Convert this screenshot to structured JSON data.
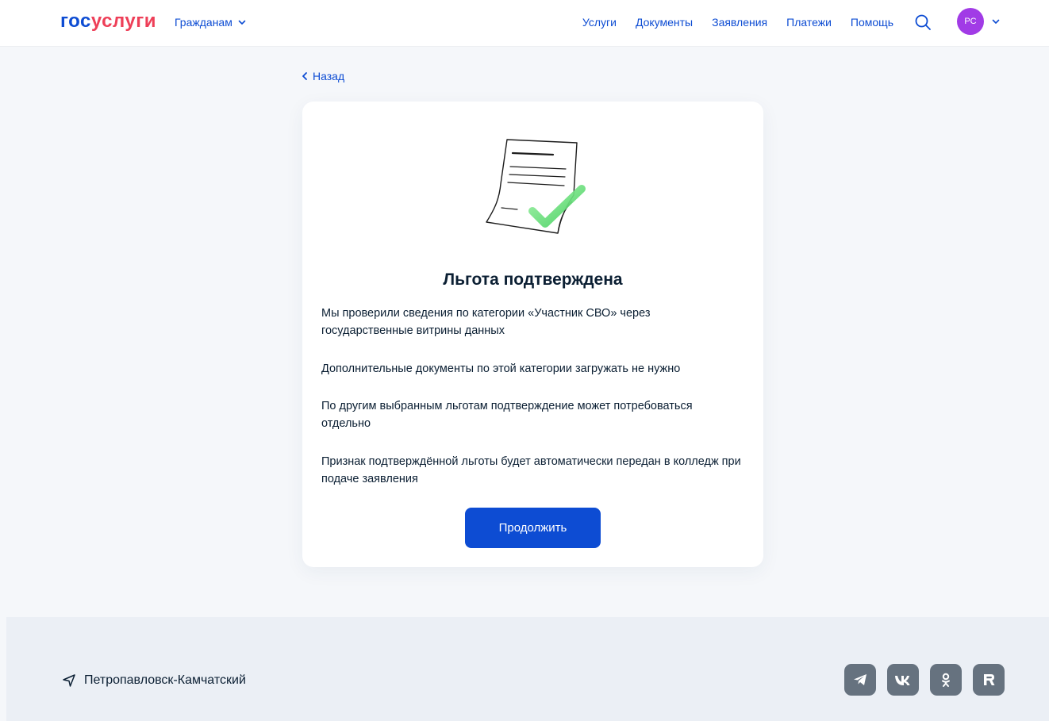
{
  "header": {
    "logo_part1": "гос",
    "logo_part2": "услуги",
    "citizens_label": "Гражданам",
    "nav": [
      "Услуги",
      "Документы",
      "Заявления",
      "Платежи",
      "Помощь"
    ],
    "avatar_initials": "РС"
  },
  "main": {
    "back_label": "Назад",
    "title": "Льгота подтверждена",
    "paragraphs": [
      "Мы проверили сведения по категории «Участник СВО» через государственные витрины данных",
      "Дополнительные документы по этой категории загружать не нужно",
      "По другим выбранным льготам подтверждение может потребоваться отдельно",
      "Признак подтверждённой льготы будет автоматически передан в колледж при подаче заявления"
    ],
    "continue_label": "Продолжить"
  },
  "footer": {
    "location": "Петропавловск-Камчатский",
    "socials": [
      "telegram-icon",
      "vk-icon",
      "odnoklassniki-icon",
      "rutube-icon"
    ]
  },
  "colors": {
    "brand_blue": "#0d4cd3",
    "brand_red": "#ee3f58",
    "avatar_bg": "#a13be6",
    "social_bg": "#66727f",
    "footer_bg": "#ebeff5"
  }
}
